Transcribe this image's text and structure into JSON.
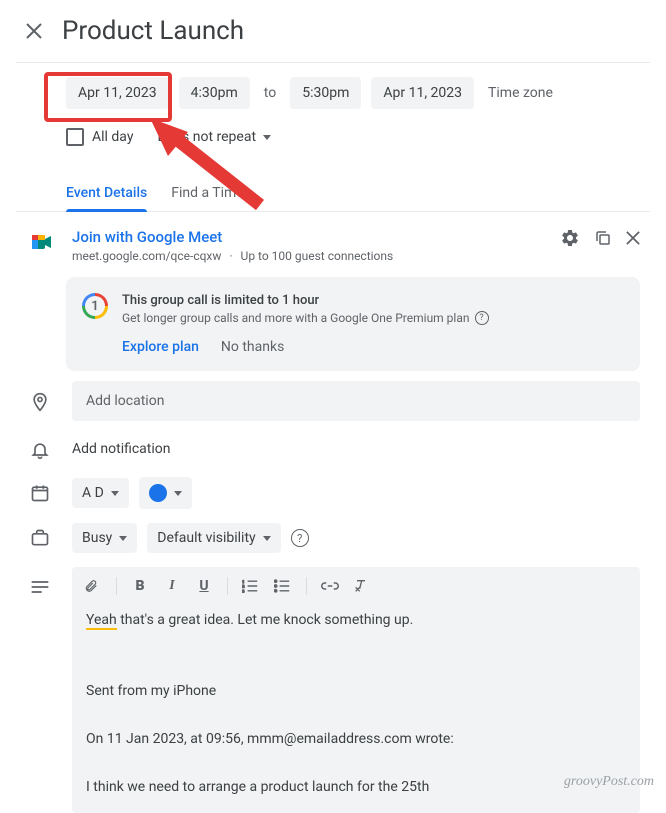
{
  "title": "Product Launch",
  "date_row": {
    "start_date": "Apr 11, 2023",
    "start_time": "4:30pm",
    "to_label": "to",
    "end_time": "5:30pm",
    "end_date": "Apr 11, 2023",
    "timezone_label": "Time zone"
  },
  "all_day_label": "All day",
  "repeat_label": "Does not repeat",
  "tabs": {
    "details": "Event Details",
    "find_time": "Find a Time"
  },
  "meet": {
    "join_label": "Join with Google Meet",
    "url": "meet.google.com/qce-cqxw",
    "capacity": "Up to 100 guest connections"
  },
  "promo": {
    "title": "This group call is limited to 1 hour",
    "subtitle": "Get longer group calls and more with a Google One Premium plan",
    "explore": "Explore plan",
    "dismiss": "No thanks"
  },
  "location_placeholder": "Add location",
  "notification_label": "Add notification",
  "calendar_owner": "A D",
  "busy_label": "Busy",
  "visibility_label": "Default visibility",
  "description": {
    "line1_highlight": "Yeah",
    "line1_rest": " that's a great idea. Let me knock something up.",
    "line2": "Sent from my iPhone",
    "line3": "On 11 Jan 2023, at 09:56, mmm@emailaddress.com wrote:",
    "line4": "I think we need to arrange a product launch for the 25th"
  },
  "watermark": "groovyPost.com"
}
